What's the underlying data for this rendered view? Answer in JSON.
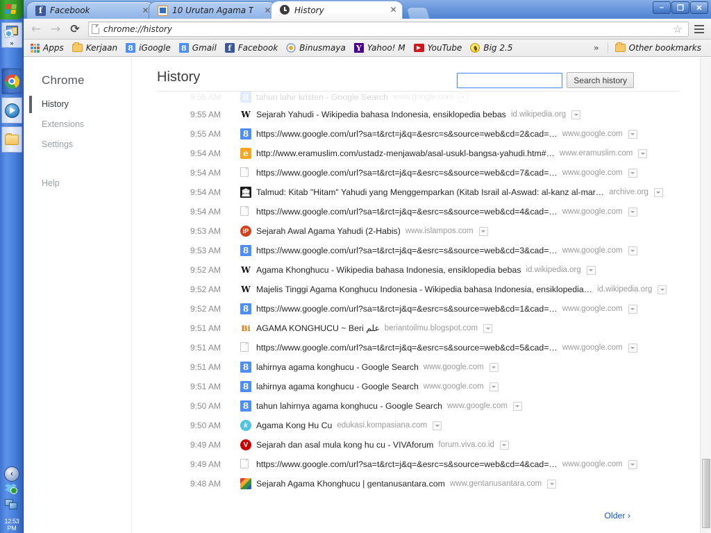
{
  "taskbar": {
    "start_label": "start",
    "clock": "12:53 PM",
    "tray_expand": "‹",
    "quicklaunch_chevrons": "»"
  },
  "window": {
    "controls": {
      "minimize": "–",
      "maximize": "❐",
      "close": "✕"
    }
  },
  "tabs": [
    {
      "title": "Facebook",
      "close": "✕",
      "favicon": "facebook-icon",
      "active": false
    },
    {
      "title": "10 Urutan Agama T",
      "close": "✕",
      "favicon": "generic-blue-icon",
      "active": false
    },
    {
      "title": "History",
      "close": "✕",
      "favicon": "clock-icon",
      "active": true
    }
  ],
  "toolbar": {
    "back": "←",
    "forward": "→",
    "reload": "⟳",
    "url": "chrome://history",
    "star": "☆"
  },
  "bookmarks": [
    {
      "label": "Apps",
      "icon": "apps-grid-icon"
    },
    {
      "label": "Kerjaan",
      "icon": "folder-icon"
    },
    {
      "label": "iGoogle",
      "icon": "google-icon"
    },
    {
      "label": "Gmail",
      "icon": "google-icon"
    },
    {
      "label": "Facebook",
      "icon": "facebook-icon"
    },
    {
      "label": "Binusmaya",
      "icon": "binusmaya-icon"
    },
    {
      "label": "Yahoo! M",
      "icon": "yahoo-icon"
    },
    {
      "label": "YouTube",
      "icon": "youtube-icon"
    },
    {
      "label": "Big 2.5",
      "icon": "big-icon"
    }
  ],
  "bookmarks_overflow": "»",
  "other_bookmarks": {
    "label": "Other bookmarks",
    "icon": "folder-icon"
  },
  "sidebar": {
    "title": "Chrome",
    "items": [
      {
        "label": "History",
        "selected": true
      },
      {
        "label": "Extensions",
        "selected": false
      },
      {
        "label": "Settings",
        "selected": false
      },
      {
        "label": "Help",
        "selected": false
      }
    ]
  },
  "main": {
    "heading": "History",
    "search": {
      "value": "",
      "placeholder": ""
    },
    "search_button": "Search history",
    "older_link": "Older ›",
    "row_menu_glyph": "▾"
  },
  "history_rows": [
    {
      "time": "9:55 AM",
      "icon": "google-icon",
      "icon_text": "8",
      "icon_class": "fi-google",
      "title": "tahun lahir kristen - Google Search",
      "host": "www.google.com",
      "ghost": true
    },
    {
      "time": "9:55 AM",
      "icon": "wikipedia-icon",
      "icon_text": "W",
      "icon_class": "fi-wiki",
      "title": "Sejarah Yahudi - Wikipedia bahasa Indonesia, ensiklopedia bebas",
      "host": "id.wikipedia.org",
      "ghost": false
    },
    {
      "time": "9:55 AM",
      "icon": "google-icon",
      "icon_text": "8",
      "icon_class": "fi-google",
      "title": "https://www.google.com/url?sa=t&rct=j&q=&esrc=s&source=web&cd=2&cad=…",
      "host": "www.google.com",
      "ghost": false
    },
    {
      "time": "9:54 AM",
      "icon": "eramuslim-icon",
      "icon_text": "e",
      "icon_class": "fi-eram",
      "title": "http://www.eramuslim.com/ustadz-menjawab/asal-usukl-bangsa-yahudi.htm#…",
      "host": "www.eramuslim.com",
      "ghost": false
    },
    {
      "time": "9:54 AM",
      "icon": "page-icon",
      "icon_text": "",
      "icon_class": "fi-blank",
      "title": "https://www.google.com/url?sa=t&rct=j&q=&esrc=s&source=web&cd=7&cad=…",
      "host": "www.google.com",
      "ghost": false
    },
    {
      "time": "9:54 AM",
      "icon": "archive-icon",
      "icon_text": "🏛",
      "icon_class": "fi-archive",
      "title": "Talmud: Kitab \"Hitam\" Yahudi yang Menggemparkan (Kitab Israil al-Aswad: al-kanz al-mar…",
      "host": "archive.org",
      "ghost": false
    },
    {
      "time": "9:54 AM",
      "icon": "page-icon",
      "icon_text": "",
      "icon_class": "fi-blank",
      "title": "https://www.google.com/url?sa=t&rct=j&q=&esrc=s&source=web&cd=4&cad=…",
      "host": "www.google.com",
      "ghost": false
    },
    {
      "time": "9:53 AM",
      "icon": "islampos-icon",
      "icon_text": "iP",
      "icon_class": "fi-islampos",
      "title": "Sejarah Awal Agama Yahudi (2-Habis)",
      "host": "www.islampos.com",
      "ghost": false
    },
    {
      "time": "9:53 AM",
      "icon": "google-icon",
      "icon_text": "8",
      "icon_class": "fi-google",
      "title": "https://www.google.com/url?sa=t&rct=j&q=&esrc=s&source=web&cd=3&cad=…",
      "host": "www.google.com",
      "ghost": false
    },
    {
      "time": "9:52 AM",
      "icon": "wikipedia-icon",
      "icon_text": "W",
      "icon_class": "fi-wiki",
      "title": "Agama Khonghucu - Wikipedia bahasa Indonesia, ensiklopedia bebas",
      "host": "id.wikipedia.org",
      "ghost": false
    },
    {
      "time": "9:52 AM",
      "icon": "wikipedia-icon",
      "icon_text": "W",
      "icon_class": "fi-wiki",
      "title": "Majelis Tinggi Agama Konghucu Indonesia - Wikipedia bahasa Indonesia, ensiklopedia…",
      "host": "id.wikipedia.org",
      "ghost": false
    },
    {
      "time": "9:52 AM",
      "icon": "google-icon",
      "icon_text": "8",
      "icon_class": "fi-google",
      "title": "https://www.google.com/url?sa=t&rct=j&q=&esrc=s&source=web&cd=1&cad=…",
      "host": "www.google.com",
      "ghost": false
    },
    {
      "time": "9:51 AM",
      "icon": "blogspot-icon",
      "icon_text": "Bi",
      "icon_class": "fi-blogspot",
      "title": "AGAMA KONGHUCU ~ Beri علم",
      "host": "beriantoilmu.blogspot.com",
      "ghost": false
    },
    {
      "time": "9:51 AM",
      "icon": "page-icon",
      "icon_text": "",
      "icon_class": "fi-blank",
      "title": "https://www.google.com/url?sa=t&rct=j&q=&esrc=s&source=web&cd=5&cad=…",
      "host": "www.google.com",
      "ghost": false
    },
    {
      "time": "9:51 AM",
      "icon": "google-icon",
      "icon_text": "8",
      "icon_class": "fi-google",
      "title": "lahirnya agama konghucu - Google Search",
      "host": "www.google.com",
      "ghost": false
    },
    {
      "time": "9:51 AM",
      "icon": "google-icon",
      "icon_text": "8",
      "icon_class": "fi-google",
      "title": "lahirnya agama konghucu - Google Search",
      "host": "www.google.com",
      "ghost": false
    },
    {
      "time": "9:50 AM",
      "icon": "google-icon",
      "icon_text": "8",
      "icon_class": "fi-google",
      "title": "tahun lahirnya agama konghucu - Google Search",
      "host": "www.google.com",
      "ghost": false
    },
    {
      "time": "9:50 AM",
      "icon": "kompasiana-icon",
      "icon_text": "k",
      "icon_class": "fi-kompas",
      "title": "Agama Kong Hu Cu",
      "host": "edukasi.kompasiana.com",
      "ghost": false
    },
    {
      "time": "9:49 AM",
      "icon": "viva-icon",
      "icon_text": "V",
      "icon_class": "fi-viva",
      "title": "Sejarah dan asal mula kong hu cu - VIVAforum",
      "host": "forum.viva.co.id",
      "ghost": false
    },
    {
      "time": "9:49 AM",
      "icon": "page-icon",
      "icon_text": "",
      "icon_class": "fi-blank",
      "title": "https://www.google.com/url?sa=t&rct=j&q=&esrc=s&source=web&cd=4&cad=…",
      "host": "www.google.com",
      "ghost": false
    },
    {
      "time": "9:48 AM",
      "icon": "gentanusantara-icon",
      "icon_text": "",
      "icon_class": "fi-gentan",
      "title": "Sejarah Agama Khonghucu | gentanusantara.com",
      "host": "www.gentanusantara.com",
      "ghost": false
    }
  ],
  "colors": {
    "accent_blue": "#4d90fe",
    "link_blue": "#1155cc",
    "taskbar_blue": "#4a81dd",
    "start_green": "#369526",
    "sidebar_selected": "#58616e"
  }
}
